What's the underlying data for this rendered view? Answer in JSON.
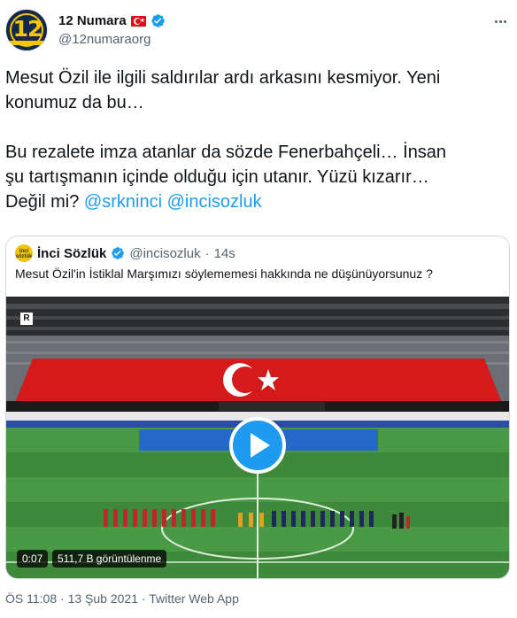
{
  "author": {
    "display_name": "12 Numara",
    "handle": "@12numaraorg",
    "avatar_text": "12"
  },
  "tweet": {
    "line1": "Mesut Özil ile ilgili saldırılar ardı arkasını kesmiyor. Yeni\nkonumuz da bu…",
    "line2": "Bu rezalete imza atanlar da sözde Fenerbahçeli… İnsan\nşu tartışmanın içinde olduğu için utanır. Yüzü kızarır…\nDeğil mi? ",
    "mention1": "@srkninci",
    "mention2": "@incisozluk"
  },
  "quote": {
    "display_name": "İnci Sözlük",
    "handle": "@incisozluk",
    "separator": "·",
    "age": "14s",
    "avatar_text": "inci sözlük",
    "text": "Mesut Özil'in İstiklal Marşımızı söylememesi hakkında ne düşünüyorsunuz ?",
    "video": {
      "duration": "0:07",
      "views": "511,7 B görüntülenme",
      "rating_badge": "R"
    }
  },
  "footer": {
    "time": "ÖS 11:08",
    "separator": "·",
    "date": "13 Şub 2021",
    "source": "Twitter Web App"
  },
  "colors": {
    "accent": "#1d9bf0",
    "text": "#0f1419",
    "muted": "#536471",
    "flag_red": "#e30a17"
  },
  "icons": [
    "verified-badge-icon",
    "turkey-flag-icon",
    "more-options-icon",
    "play-icon"
  ]
}
